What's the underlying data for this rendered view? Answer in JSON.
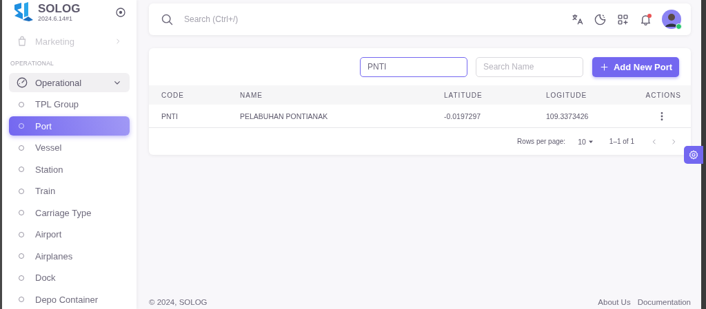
{
  "app": {
    "name": "SOLOG",
    "version": "2024.6.14#1"
  },
  "sidebar": {
    "items": [
      {
        "label": "Marketing",
        "disabled": true
      }
    ],
    "section": "OPERATIONAL",
    "group": {
      "label": "Operational",
      "expanded": true,
      "children": [
        {
          "label": "TPL Group",
          "selected": false
        },
        {
          "label": "Port",
          "selected": true
        },
        {
          "label": "Vessel",
          "selected": false
        },
        {
          "label": "Station",
          "selected": false
        },
        {
          "label": "Train",
          "selected": false
        },
        {
          "label": "Carriage Type",
          "selected": false
        },
        {
          "label": "Airport",
          "selected": false
        },
        {
          "label": "Airplanes",
          "selected": false
        },
        {
          "label": "Dock",
          "selected": false
        },
        {
          "label": "Depo Container",
          "selected": false
        }
      ]
    }
  },
  "navbar": {
    "search": {
      "placeholder": "Search (Ctrl+/)"
    },
    "notifications_unread": true,
    "user_online": true
  },
  "toolbar": {
    "filters": [
      {
        "value": "PNTI",
        "focused": true
      },
      {
        "placeholder": "Search Name",
        "focused": false
      }
    ],
    "add_button": "Add New Port"
  },
  "table": {
    "columns": [
      "CODE",
      "NAME",
      "LATITUDE",
      "LOGITUDE",
      "ACTIONS"
    ],
    "rows": [
      {
        "code": "PNTI",
        "name": "PELABUHAN PONTIANAK",
        "latitude": "-0.0197297",
        "longitude": "109.3373426"
      }
    ]
  },
  "pagination": {
    "rows_per_page_label": "Rows per page:",
    "rows_per_page": "10",
    "range": "1–1 of 1"
  },
  "footer": {
    "copyright": "© 2024, SOLOG",
    "links": [
      "About Us",
      "Documentation"
    ]
  }
}
